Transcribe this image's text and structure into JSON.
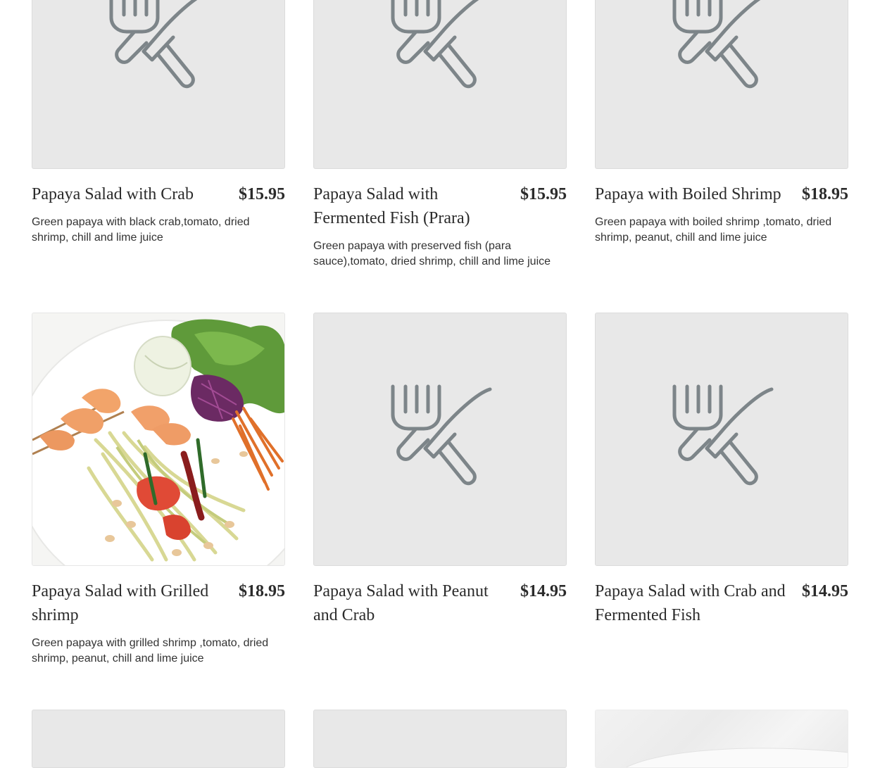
{
  "menu": {
    "items": [
      {
        "name": "Papaya Salad with Crab",
        "price": "$15.95",
        "description": "Green papaya with black crab,tomato, dried shrimp, chill and lime juice",
        "image": "placeholder-utensils-icon"
      },
      {
        "name": "Papaya Salad with Fermented Fish (Prara)",
        "price": "$15.95",
        "description": "Green papaya with preserved fish (para sauce),tomato, dried shrimp, chill and lime juice",
        "image": "placeholder-utensils-icon"
      },
      {
        "name": "Papaya with Boiled Shrimp",
        "price": "$18.95",
        "description": "Green papaya with boiled shrimp ,tomato, dried shrimp, peanut, chill and lime juice",
        "image": "placeholder-utensils-icon"
      },
      {
        "name": "Papaya Salad with Grilled shrimp",
        "price": "$18.95",
        "description": "Green papaya with grilled shrimp ,tomato, dried shrimp, peanut, chill and lime juice",
        "image": "dish-photo"
      },
      {
        "name": "Papaya Salad with Peanut and Crab",
        "price": "$14.95",
        "description": "",
        "image": "placeholder-utensils-icon"
      },
      {
        "name": "Papaya Salad with Crab and Fermented Fish",
        "price": "$14.95",
        "description": "",
        "image": "placeholder-utensils-icon"
      }
    ]
  },
  "colors": {
    "placeholder_bg": "#e8e8e8",
    "icon_stroke": "#7d8589",
    "text": "#2b2b2b"
  }
}
